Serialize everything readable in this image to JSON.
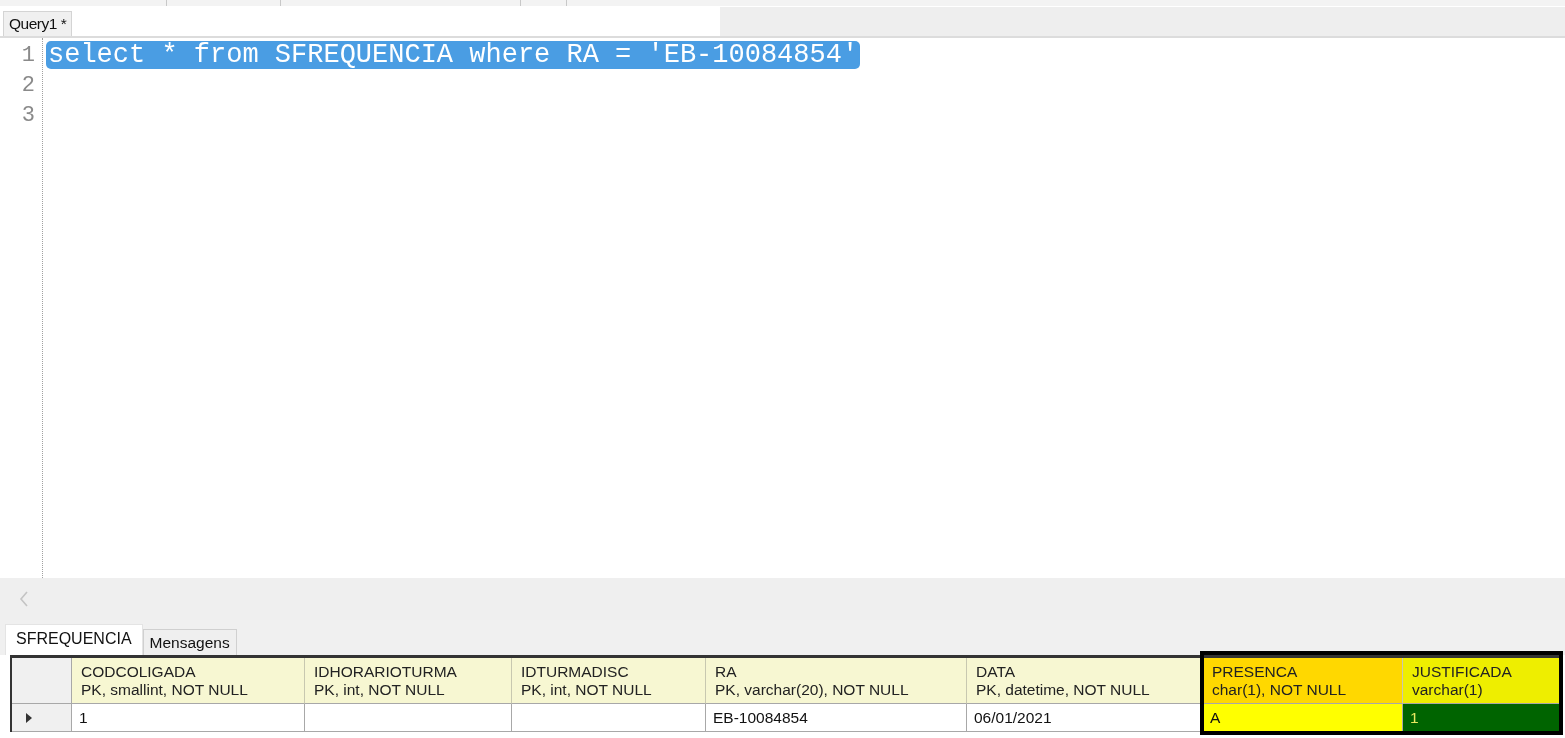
{
  "editor_tabs": [
    {
      "label": "Query1 *",
      "selected": true
    }
  ],
  "editor": {
    "lines": [
      {
        "number": "1",
        "text": "select * from SFREQUENCIA where RA = 'EB-10084854'",
        "selected": true
      },
      {
        "number": "2",
        "selected": false
      },
      {
        "number": "3",
        "selected": false
      }
    ]
  },
  "result_tabs": [
    {
      "label": "SFREQUENCIA",
      "selected": true
    },
    {
      "label": "Mensagens",
      "selected": false
    }
  ],
  "grid": {
    "columns": [
      {
        "name": "CODCOLIGADA",
        "type": "PK, smallint, NOT NULL",
        "color": "#f7f7d2",
        "outlined": false
      },
      {
        "name": "IDHORARIOTURMA",
        "type": "PK, int, NOT NULL",
        "color": "#f7f7d2",
        "outlined": false
      },
      {
        "name": "IDTURMADISC",
        "type": "PK, int, NOT NULL",
        "color": "#f7f7d2",
        "outlined": false
      },
      {
        "name": "RA",
        "type": "PK, varchar(20), NOT NULL",
        "color": "#f7f7d2",
        "outlined": false
      },
      {
        "name": "DATA",
        "type": "PK, datetime, NOT NULL",
        "color": "#f7f7d2",
        "outlined": false
      },
      {
        "name": "PRESENCA",
        "type": "char(1), NOT NULL",
        "color": "#ffd800",
        "outlined": true
      },
      {
        "name": "JUSTIFICADA",
        "type": "varchar(1)",
        "color": "#eeee00",
        "outlined": true
      }
    ],
    "rows": [
      {
        "current": true,
        "cells": [
          {
            "text": "1"
          },
          {},
          {},
          {
            "text": "EB-10084854"
          },
          {
            "text": "06/01/2021"
          },
          {
            "text": "A",
            "color": "#ffff00"
          },
          {
            "text": "1",
            "color": "#006400"
          }
        ]
      }
    ]
  }
}
